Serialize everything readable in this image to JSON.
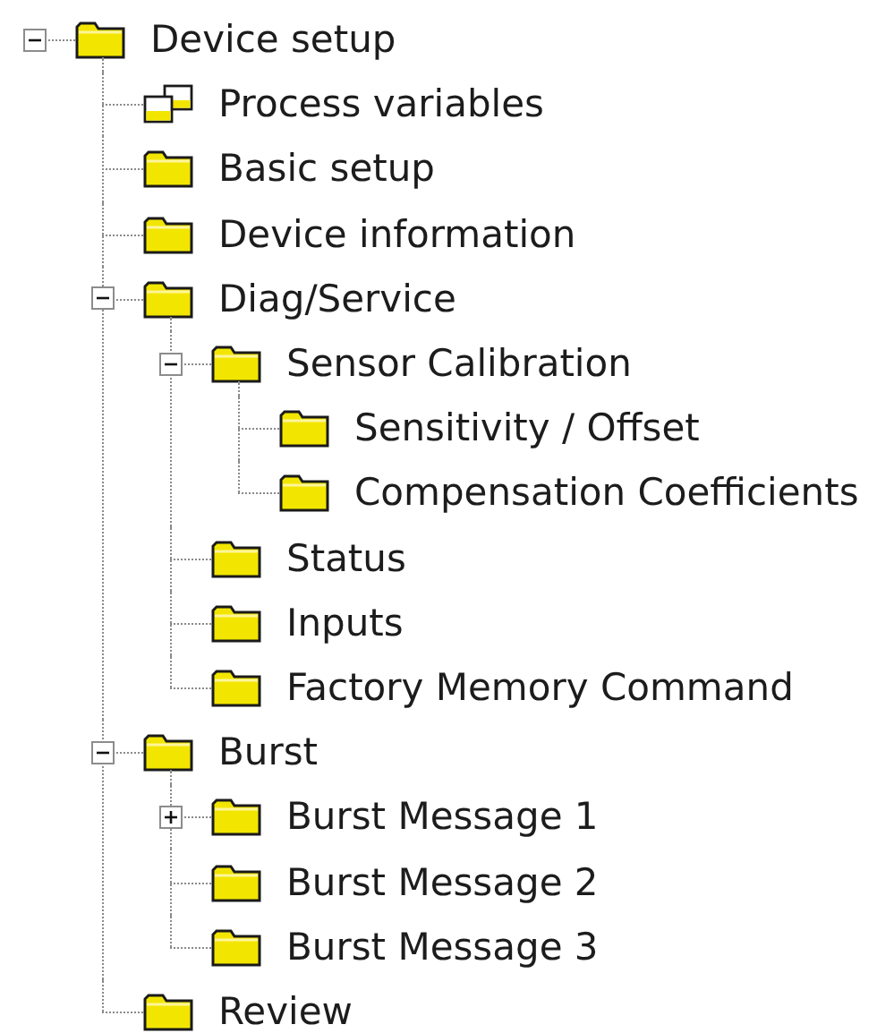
{
  "tree": [
    {
      "label": "Device setup",
      "kind": "folder",
      "expanded": true,
      "children": [
        {
          "label": "Process variables",
          "kind": "variables"
        },
        {
          "label": "Basic setup",
          "kind": "folder"
        },
        {
          "label": "Device information",
          "kind": "folder"
        },
        {
          "label": "Diag/Service",
          "kind": "folder",
          "expanded": true,
          "children": [
            {
              "label": "Sensor Calibration",
              "kind": "folder",
              "expanded": true,
              "children": [
                {
                  "label": "Sensitivity / Offset",
                  "kind": "folder"
                },
                {
                  "label": "Compensation Coefficients",
                  "kind": "folder"
                }
              ]
            },
            {
              "label": "Status",
              "kind": "folder"
            },
            {
              "label": "Inputs",
              "kind": "folder"
            },
            {
              "label": "Factory Memory Command",
              "kind": "folder"
            }
          ]
        },
        {
          "label": "Burst",
          "kind": "folder",
          "expanded": true,
          "children": [
            {
              "label": "Burst Message 1",
              "kind": "folder",
              "expanded": false
            },
            {
              "label": "Burst Message 2",
              "kind": "folder"
            },
            {
              "label": "Burst Message 3",
              "kind": "folder"
            }
          ]
        },
        {
          "label": "Review",
          "kind": "folder"
        }
      ]
    }
  ]
}
